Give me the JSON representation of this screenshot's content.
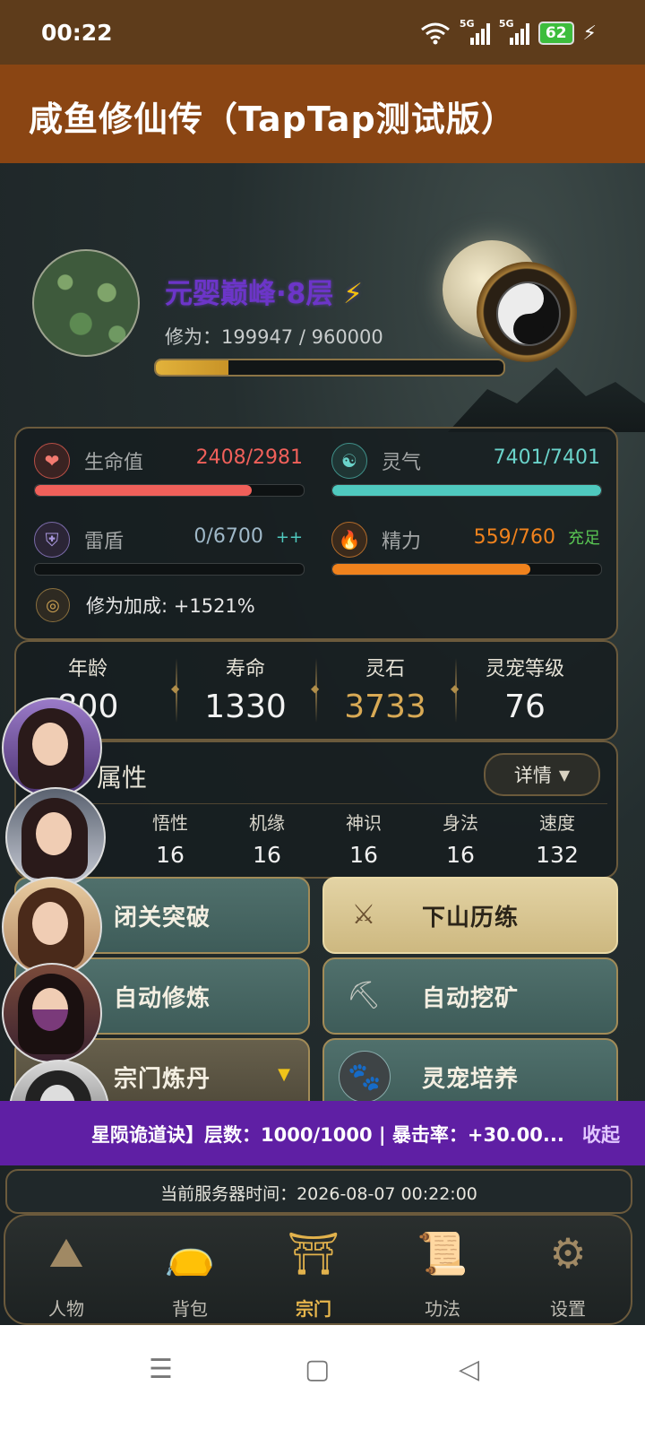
{
  "status_bar": {
    "time": "00:22",
    "battery": "62",
    "net1": "5G",
    "net2": "5G"
  },
  "app": {
    "title": "咸鱼修仙传（TapTap测试版）"
  },
  "player": {
    "realm": "元婴巅峰·8层",
    "realm_suffix": "⚡",
    "cultivation_label": "修为：",
    "cultivation_value": "199947 / 960000",
    "cultivation_progress": 0.208
  },
  "stats": {
    "hp": {
      "label": "生命值",
      "value": "2408/2981",
      "color": "#f0605a",
      "progress": 0.808
    },
    "spirit": {
      "label": "灵气",
      "value": "7401/7401",
      "color": "#4fc9bf",
      "progress": 1.0
    },
    "shield": {
      "label": "雷盾",
      "value": "0/6700",
      "extra": "++",
      "color": "#4fc9bf",
      "progress": 0.0
    },
    "energy": {
      "label": "精力",
      "value": "559/760",
      "extra": "充足",
      "color": "#f0821d",
      "progress": 0.735
    },
    "bonus": "修为加成: +1521%"
  },
  "info": [
    {
      "label": "年龄",
      "value": "800"
    },
    {
      "label": "寿命",
      "value": "1330"
    },
    {
      "label": "灵石",
      "value": "3733"
    },
    {
      "label": "灵宠等级",
      "value": "76"
    }
  ],
  "attributes": {
    "title": "属性",
    "detail_btn": "详情",
    "items": [
      {
        "label": "悟性",
        "value": "16"
      },
      {
        "label": "机缘",
        "value": "16"
      },
      {
        "label": "神识",
        "value": "16"
      },
      {
        "label": "身法",
        "value": "16"
      },
      {
        "label": "速度",
        "value": "132"
      }
    ]
  },
  "actions": {
    "breakthrough": "闭关突破",
    "adventure": "下山历练",
    "auto_train": "自动修炼",
    "auto_mine": "自动挖矿",
    "alchemy": "宗门炼丹",
    "pet": "灵宠培养"
  },
  "banner": {
    "message": "星陨诡道诀】层数：1000/1000 | 暴击率：+30.00...",
    "collapse": "收起"
  },
  "server_time": "当前服务器时间：2026-08-07 00:22:00",
  "nav": [
    {
      "label": "人物",
      "icon": "mountain-icon"
    },
    {
      "label": "背包",
      "icon": "bag-icon"
    },
    {
      "label": "宗门",
      "icon": "temple-icon"
    },
    {
      "label": "功法",
      "icon": "scroll-icon"
    },
    {
      "label": "设置",
      "icon": "gear-icon"
    }
  ]
}
